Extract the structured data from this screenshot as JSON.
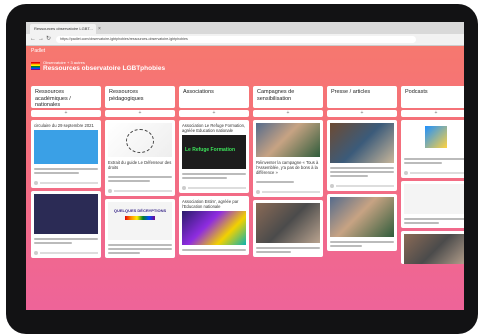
{
  "browser": {
    "tab_title": "Ressources observatoire LGBT...",
    "url": "https://padlet.com/observatoire-lgbtphobies/ressources-observatoire-lgbtphobies",
    "nav_back": "←",
    "nav_forward": "→",
    "nav_reload": "↻",
    "tab_close": "×"
  },
  "board": {
    "brand": "Padlet",
    "author": "Observatoire + 3 autres",
    "title": "Ressources observatoire LGBTphobies",
    "flag_colors": [
      "#e40303",
      "#ff8c00",
      "#ffed00",
      "#008026",
      "#004dff",
      "#750787"
    ]
  },
  "columns": [
    {
      "title": "Ressources académiques / nationales",
      "add": "+",
      "cards": [
        {
          "text": "circulaire du 29 septembre 2021",
          "image": "blue"
        },
        {
          "text": "",
          "image": "dark2"
        }
      ]
    },
    {
      "title": "Ressources pédagogiques",
      "add": "+",
      "cards": [
        {
          "text": "",
          "image": "diagram",
          "caption": "Extrait du guide Le Défenseur des droits"
        },
        {
          "text": "",
          "image": "book",
          "book_title": "QUELQUES DÉCRYPTIONS"
        }
      ]
    },
    {
      "title": "Associations",
      "add": "+",
      "cards": [
        {
          "text": "Association Le Refuge Formation, agréée Education nationale",
          "image": "green",
          "image_text": "Le Refuge Formation"
        },
        {
          "text": "Association Estim', agréée par l'Education nationale",
          "image": "purple"
        }
      ]
    },
    {
      "title": "Campagnes de sensibilisation",
      "add": "+",
      "cards": [
        {
          "text": "Réinventer la campagne « Tous à l'Assemblée, y'a pas de bons à la différence »",
          "image": "photo"
        },
        {
          "text": "",
          "image": "photo2"
        }
      ]
    },
    {
      "title": "Presse / articles",
      "add": "+",
      "cards": [
        {
          "text": "",
          "image": "photo3"
        },
        {
          "text": "",
          "image": "photo"
        }
      ]
    },
    {
      "title": "Podcasts",
      "add": "+",
      "cards": [
        {
          "text": "",
          "image": "square"
        },
        {
          "text": "",
          "image": "white"
        }
      ]
    }
  ]
}
